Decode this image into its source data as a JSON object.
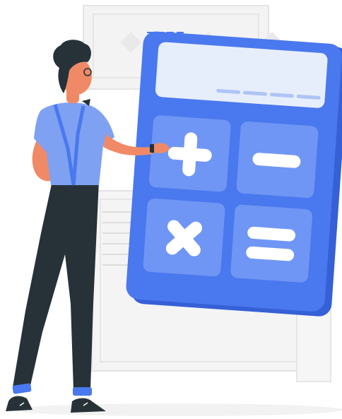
{
  "illustration": {
    "subject": "person-with-calculator",
    "colors": {
      "accent": "#4A78EE",
      "accent_dark": "#3560D6",
      "key": "#6F96F4",
      "screen": "#E7EEFB",
      "paper": "#F1F1F1",
      "paper_line": "#DCDCDC",
      "shirt": "#7FA1F1",
      "pants": "#263238",
      "skin": "#F08A66",
      "hair": "#263238",
      "shadow": "#F2F2F2"
    },
    "calculator_keys": [
      {
        "name": "plus-key",
        "icon": "plus-icon"
      },
      {
        "name": "minus-key",
        "icon": "minus-icon"
      },
      {
        "name": "multiply-key",
        "icon": "multiply-icon"
      },
      {
        "name": "equals-key",
        "icon": "equals-icon"
      }
    ]
  }
}
